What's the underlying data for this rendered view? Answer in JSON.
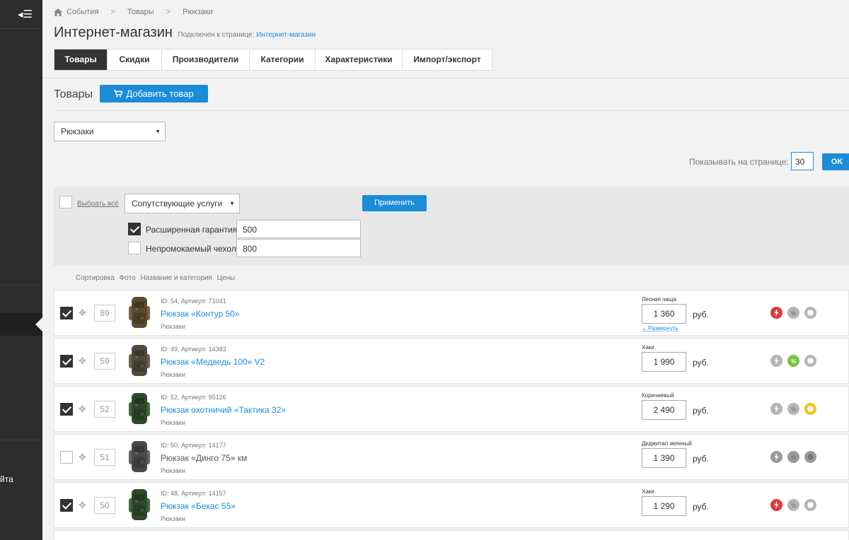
{
  "sidebar": {
    "toggle_icon": "collapse-menu-icon",
    "bottom_text": "йта"
  },
  "breadcrumb": {
    "items": [
      "События",
      "Товары",
      "Рюкзаки"
    ],
    "separator": ">"
  },
  "header": {
    "title": "Интернет-магазин",
    "connected_label": "Подключен к странице:",
    "connected_link": "Интернет-магазин"
  },
  "tabs": [
    "Товары",
    "Скидки",
    "Производители",
    "Категории",
    "Характеристики",
    "Импорт/экспорт"
  ],
  "products_section": {
    "title": "Товары",
    "add_button": "Добавить товар"
  },
  "filter": {
    "category_select": "Рюкзаки"
  },
  "pagination": {
    "label": "Показывать на странице:",
    "value": "30",
    "ok_button": "OK"
  },
  "bulk": {
    "select_all": "Выбрать всё",
    "action_select": "Сопутствующие услуги",
    "apply_button": "Применить",
    "services": [
      {
        "label": "Расширенная гарантия",
        "value": "500",
        "checked": true
      },
      {
        "label": "Непромокаемый чехол",
        "value": "800",
        "checked": false
      }
    ]
  },
  "columns": [
    "Сортировка",
    "Фото",
    "Название и категория",
    "Цены"
  ],
  "products": [
    {
      "checked": true,
      "sort": "89",
      "meta": "ID: 54, Артикул: 71041",
      "name": "Рюкзак «Контур 50»",
      "active": true,
      "category": "Рюкзаки",
      "variant": "Лесная чаща",
      "price": "1 360",
      "currency": "руб.",
      "expand": "Развернуть",
      "icons": [
        "hit",
        "discount",
        "new"
      ],
      "icon_states": [
        "red",
        "grey",
        "grey"
      ],
      "photo_color": "#5a4a2e"
    },
    {
      "checked": true,
      "sort": "59",
      "meta": "ID: 49, Артикул: 14383",
      "name": "Рюкзак «Медведь 100» V2",
      "active": true,
      "category": "Рюкзаки",
      "variant": "Хаки",
      "price": "1 990",
      "currency": "руб.",
      "expand": "",
      "icons": [
        "hit",
        "discount",
        "new"
      ],
      "icon_states": [
        "grey",
        "green",
        "grey"
      ],
      "photo_color": "#4f4a3a"
    },
    {
      "checked": true,
      "sort": "52",
      "meta": "ID: 52, Артикул: 95126",
      "name": "Рюкзак охотничий «Тактика 32»",
      "active": true,
      "category": "Рюкзаки",
      "variant": "Коричневый",
      "price": "2 490",
      "currency": "руб.",
      "expand": "",
      "icons": [
        "hit",
        "discount",
        "new"
      ],
      "icon_states": [
        "grey",
        "grey",
        "yellow"
      ],
      "photo_color": "#2f4a2a"
    },
    {
      "checked": false,
      "sort": "51",
      "meta": "ID: 50, Артикул: 14177",
      "name": "Рюкзак «Динго 75» км",
      "active": false,
      "category": "Рюкзаки",
      "variant": "Диджитал зеленый",
      "price": "1 390",
      "currency": "руб.",
      "expand": "",
      "icons": [
        "hit",
        "discount",
        "new"
      ],
      "icon_states": [
        "dim",
        "dim",
        "dim"
      ],
      "photo_color": "#4a4a4a"
    },
    {
      "checked": true,
      "sort": "50",
      "meta": "ID: 48, Артикул: 14157",
      "name": "Рюкзак «Бекас 55»",
      "active": true,
      "category": "Рюкзаки",
      "variant": "Хаки",
      "price": "1 290",
      "currency": "руб.",
      "expand": "",
      "icons": [
        "hit",
        "discount",
        "new"
      ],
      "icon_states": [
        "red",
        "grey",
        "grey"
      ],
      "photo_color": "#2c4a2a"
    }
  ],
  "colors": {
    "accent": "#1a8cd8",
    "sidebar": "#2d2d2d",
    "active_tab": "#333333",
    "hit_red": "#e03a3a",
    "discount_green": "#7cc243",
    "new_yellow": "#f0c419"
  }
}
